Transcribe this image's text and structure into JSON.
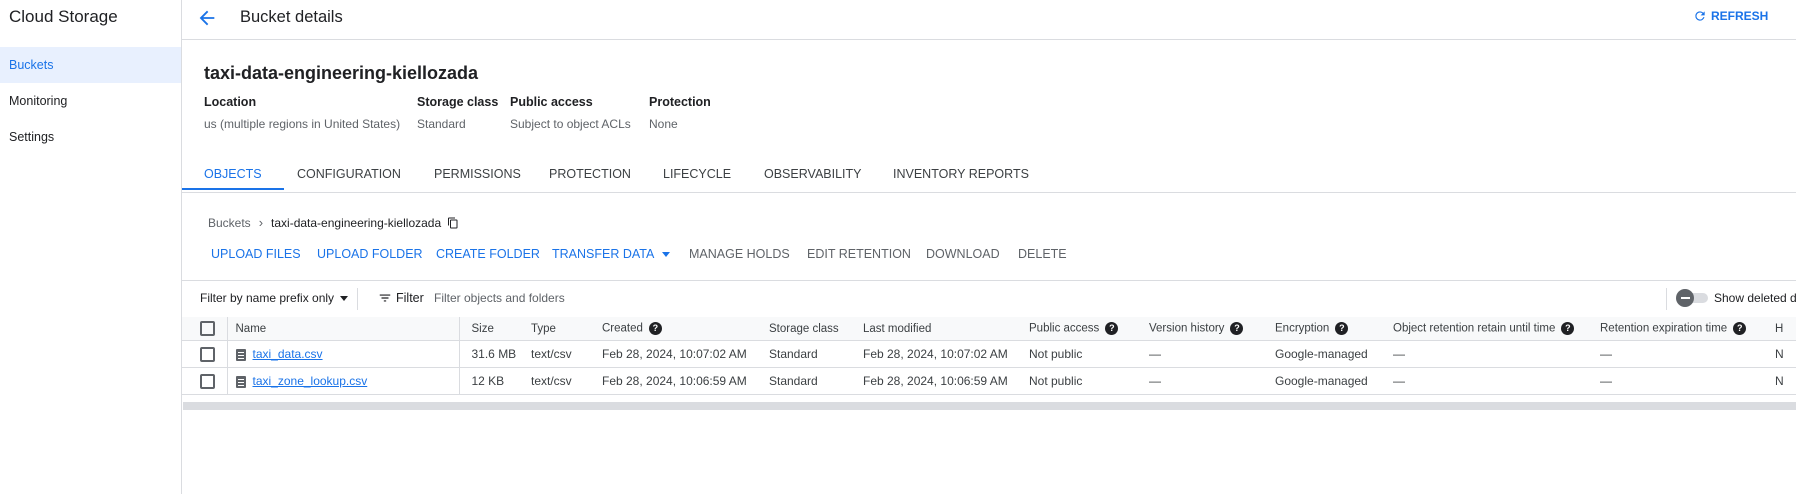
{
  "app": {
    "title": "Cloud Storage"
  },
  "sidebar": {
    "items": [
      {
        "label": "Buckets",
        "active": true
      },
      {
        "label": "Monitoring",
        "active": false
      },
      {
        "label": "Settings",
        "active": false
      }
    ]
  },
  "header": {
    "title": "Bucket details",
    "refresh_label": "REFRESH"
  },
  "bucket": {
    "name": "taxi-data-engineering-kiellozada",
    "info": [
      {
        "label": "Location",
        "value": "us (multiple regions in United States)"
      },
      {
        "label": "Storage class",
        "value": "Standard"
      },
      {
        "label": "Public access",
        "value": "Subject to object ACLs"
      },
      {
        "label": "Protection",
        "value": "None"
      }
    ]
  },
  "tabs": [
    {
      "label": "OBJECTS",
      "active": true
    },
    {
      "label": "CONFIGURATION"
    },
    {
      "label": "PERMISSIONS"
    },
    {
      "label": "PROTECTION"
    },
    {
      "label": "LIFECYCLE"
    },
    {
      "label": "OBSERVABILITY"
    },
    {
      "label": "INVENTORY REPORTS"
    }
  ],
  "breadcrumb": {
    "root": "Buckets",
    "current": "taxi-data-engineering-kiellozada"
  },
  "actions": [
    {
      "label": "UPLOAD FILES",
      "enabled": true
    },
    {
      "label": "UPLOAD FOLDER",
      "enabled": true
    },
    {
      "label": "CREATE FOLDER",
      "enabled": true
    },
    {
      "label": "TRANSFER DATA",
      "enabled": true
    },
    {
      "label": "MANAGE HOLDS",
      "enabled": false
    },
    {
      "label": "EDIT RETENTION",
      "enabled": false
    },
    {
      "label": "DOWNLOAD",
      "enabled": false
    },
    {
      "label": "DELETE",
      "enabled": false
    }
  ],
  "filterbar": {
    "prefix_label": "Filter by name prefix only",
    "filter_label": "Filter",
    "placeholder": "Filter objects and folders",
    "show_deleted_label": "Show deleted da"
  },
  "table": {
    "columns": [
      "Name",
      "Size",
      "Type",
      "Created",
      "Storage class",
      "Last modified",
      "Public access",
      "Version history",
      "Encryption",
      "Object retention retain until time",
      "Retention expiration time",
      "H"
    ],
    "rows": [
      {
        "name": "taxi_data.csv",
        "size": "31.6 MB",
        "type": "text/csv",
        "created": "Feb 28, 2024, 10:07:02 AM",
        "storage_class": "Standard",
        "last_modified": "Feb 28, 2024, 10:07:02 AM",
        "public_access": "Not public",
        "version_history": "—",
        "encryption": "Google-managed",
        "retain_until": "—",
        "retention_expiration": "—",
        "hold": "N"
      },
      {
        "name": "taxi_zone_lookup.csv",
        "size": "12 KB",
        "type": "text/csv",
        "created": "Feb 28, 2024, 10:06:59 AM",
        "storage_class": "Standard",
        "last_modified": "Feb 28, 2024, 10:06:59 AM",
        "public_access": "Not public",
        "version_history": "—",
        "encryption": "Google-managed",
        "retain_until": "—",
        "retention_expiration": "—",
        "hold": "N"
      }
    ]
  },
  "colors": {
    "accent": "#1a73e8",
    "border": "#dadce0",
    "text": "#202124",
    "muted": "#5f6368"
  }
}
